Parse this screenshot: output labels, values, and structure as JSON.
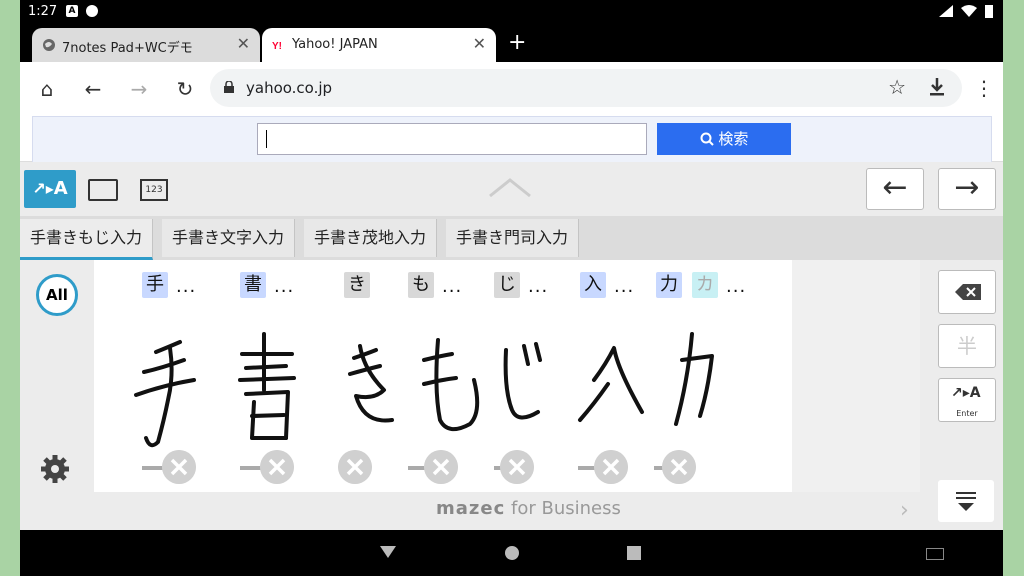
{
  "status": {
    "time": "1:27",
    "icon_a": "A"
  },
  "tabs": [
    {
      "title": "7notes Pad+WCデモ",
      "favicon": "globe-icon"
    },
    {
      "title": "Yahoo! JAPAN",
      "favicon": "yahoo-icon"
    }
  ],
  "toolbar": {
    "url": "yahoo.co.jp"
  },
  "page": {
    "search_button": "検索"
  },
  "keyboard": {
    "mode_handwriting": "A",
    "mode_numeric": "123",
    "candidates": [
      "手書きもじ入力",
      "手書き文字入力",
      "手書き茂地入力",
      "手書き門司入力"
    ],
    "all_button": "All",
    "recognized_chars": [
      "手",
      "書",
      "き",
      "も",
      "じ",
      "入",
      "力"
    ],
    "alt_char": "カ",
    "ellipsis": "...",
    "enter_label": "Enter",
    "hankaku_label": "半",
    "brand_main": "mazec",
    "brand_sub": "for Business",
    "left_arrow": "←",
    "right_arrow": "→"
  },
  "colors": {
    "accent": "#2f9cc9",
    "search_button": "#2b6df0"
  }
}
